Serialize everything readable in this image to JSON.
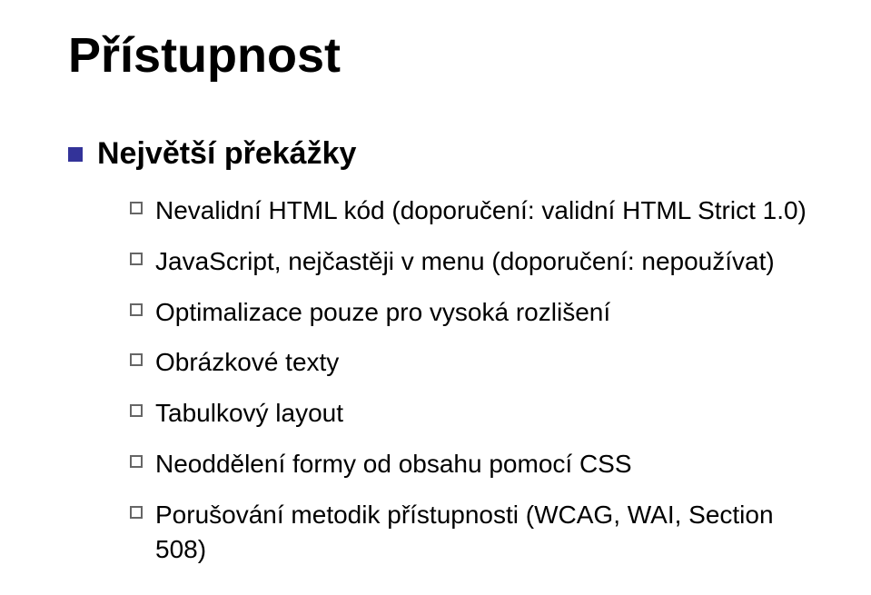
{
  "title": "Přístupnost",
  "level1": {
    "heading": "Největší překážky",
    "items": [
      "Nevalidní HTML kód (doporučení: validní HTML Strict 1.0)",
      "JavaScript, nejčastěji v menu (doporučení: nepoužívat)",
      "Optimalizace pouze pro vysoká rozlišení",
      "Obrázkové texty",
      "Tabulkový layout",
      "Neoddělení formy od obsahu pomocí CSS",
      "Porušování metodik přístupnosti (WCAG, WAI, Section 508)"
    ]
  },
  "colors": {
    "bullet_primary": "#333399",
    "bullet_outline": "#666666"
  }
}
